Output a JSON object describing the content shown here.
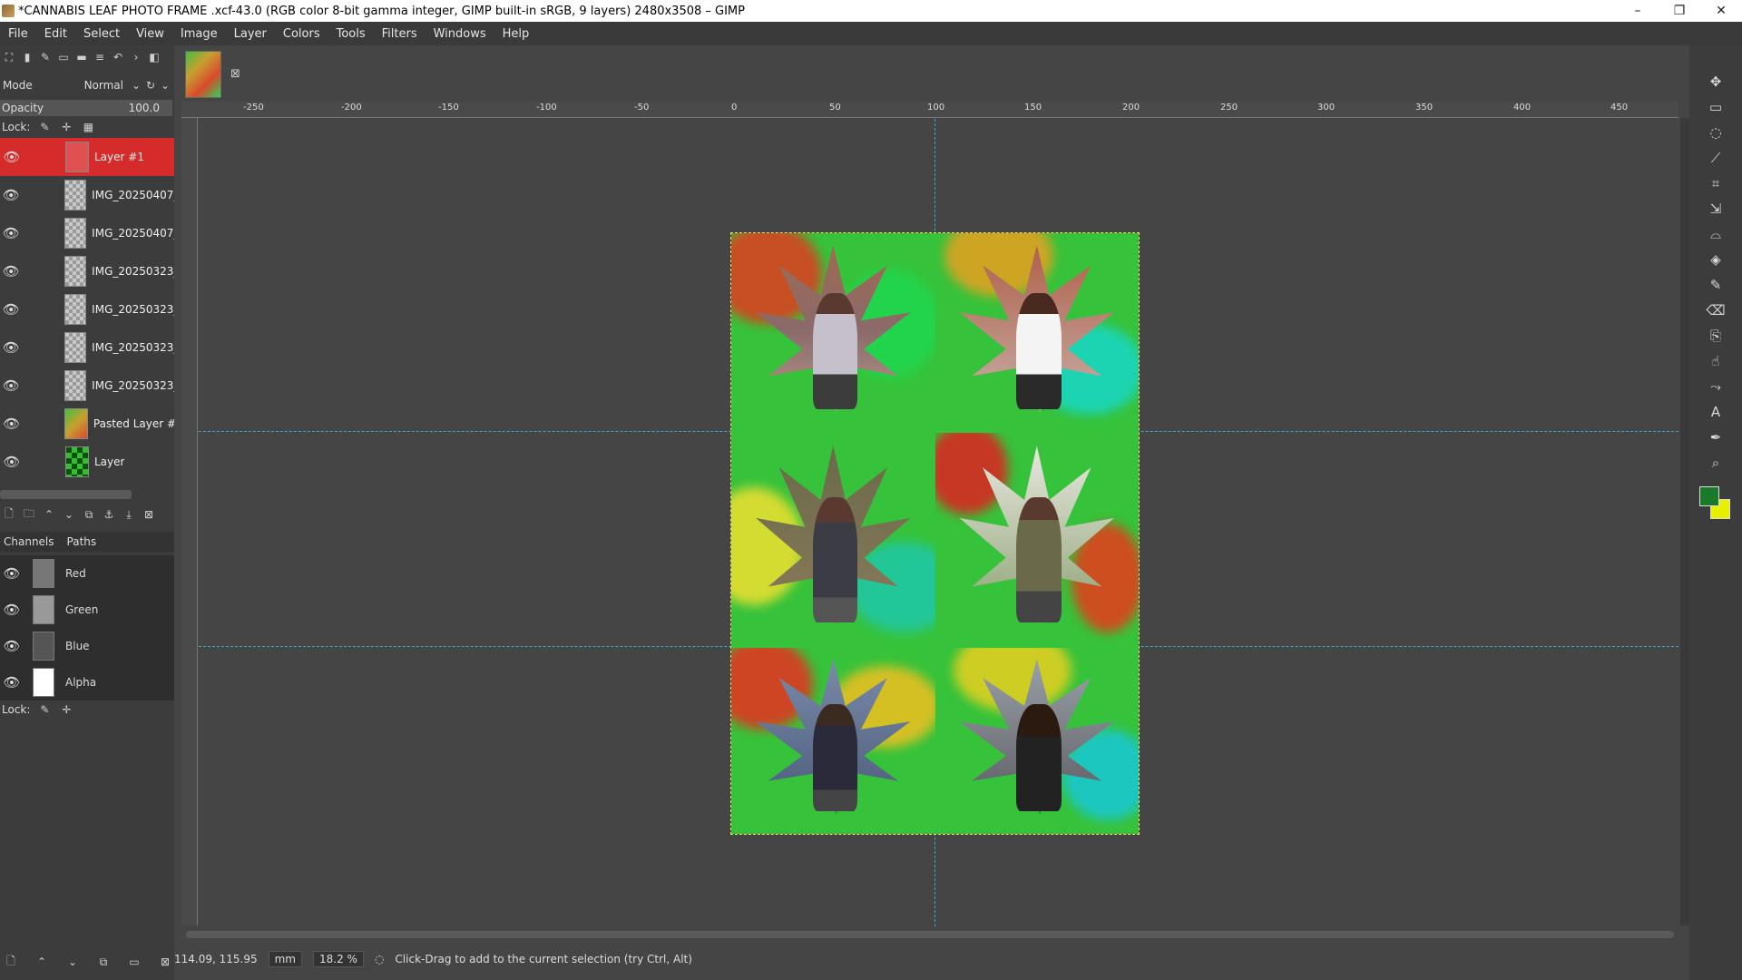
{
  "window": {
    "title": "*CANNABIS LEAF PHOTO FRAME .xcf-43.0 (RGB color 8-bit gamma integer, GIMP built-in sRGB, 9 layers) 2480x3508 – GIMP",
    "minimize": "–",
    "restore": "❐",
    "close": "✕"
  },
  "menu": [
    "File",
    "Edit",
    "Select",
    "View",
    "Image",
    "Layer",
    "Colors",
    "Tools",
    "Filters",
    "Windows",
    "Help"
  ],
  "layers_panel": {
    "mode_label": "Mode",
    "mode_value": "Normal",
    "opacity_label": "Opacity",
    "opacity_value": "100.0",
    "lock_label": "Lock:",
    "layers": [
      {
        "name": "Layer #1",
        "active": true
      },
      {
        "name": "IMG_20250407_",
        "active": false
      },
      {
        "name": "IMG_20250407_",
        "active": false
      },
      {
        "name": "IMG_20250323_",
        "active": false
      },
      {
        "name": "IMG_20250323_",
        "active": false
      },
      {
        "name": "IMG_20250323_",
        "active": false
      },
      {
        "name": "IMG_20250323_",
        "active": false
      },
      {
        "name": "Pasted Layer #",
        "active": false
      },
      {
        "name": "Layer",
        "active": false
      }
    ]
  },
  "channels_panel": {
    "tab_channels": "Channels",
    "tab_paths": "Paths",
    "channels": [
      {
        "name": "Red"
      },
      {
        "name": "Green"
      },
      {
        "name": "Blue"
      },
      {
        "name": "Alpha"
      }
    ],
    "lock_label": "Lock:"
  },
  "ruler": {
    "labels": [
      "-250",
      "-200",
      "-150",
      "-100",
      "-50",
      "0",
      "50",
      "100",
      "150",
      "200",
      "250",
      "300",
      "350",
      "400",
      "450"
    ]
  },
  "status": {
    "coords": "114.09, 115.95",
    "unit": "mm",
    "zoom": "18.2 %",
    "message": "Click-Drag to add to the current selection (try Ctrl, Alt)"
  },
  "colors": {
    "accent_active_layer": "#d62b2b",
    "guide": "#3aa6d8",
    "foreground": "#1a7a2a",
    "background": "#e8f000"
  },
  "tools": [
    "move-icon",
    "rect-select-icon",
    "lasso-icon",
    "fuzzy-select-icon",
    "crop-icon",
    "transform-icon",
    "warp-icon",
    "bucket-fill-icon",
    "paintbrush-icon",
    "eraser-icon",
    "clone-icon",
    "smudge-icon",
    "paths-icon",
    "text-icon",
    "color-picker-icon",
    "zoom-icon"
  ]
}
